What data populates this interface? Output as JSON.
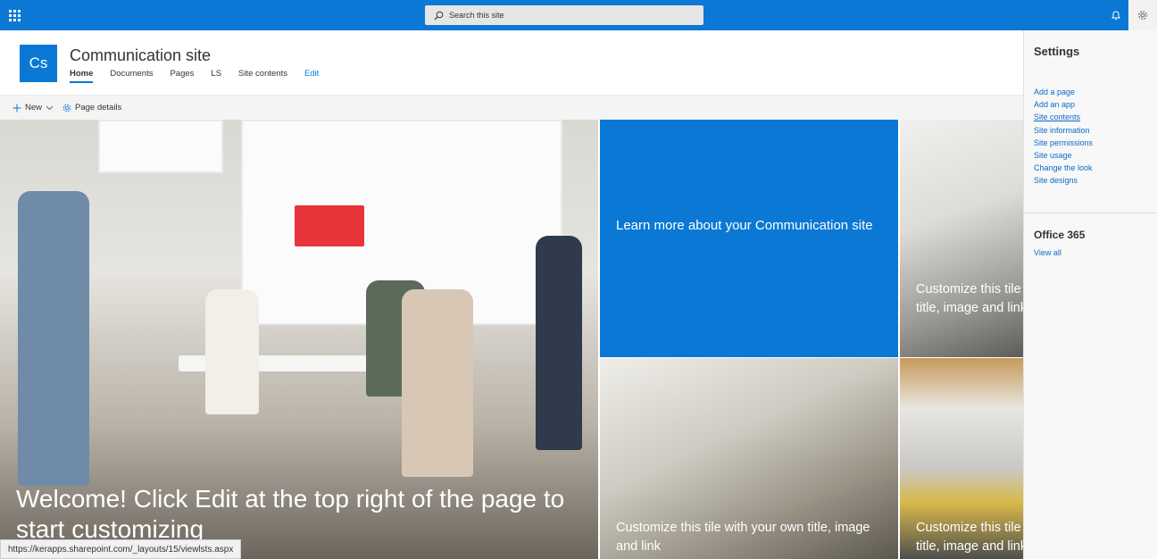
{
  "suite": {
    "search_placeholder": "Search this site"
  },
  "site": {
    "logo_initials": "Cs",
    "title": "Communication site",
    "nav": [
      "Home",
      "Documents",
      "Pages",
      "LS",
      "Site contents",
      "Edit"
    ]
  },
  "commandbar": {
    "new_label": "New",
    "page_details_label": "Page details"
  },
  "hero": {
    "main_title": "Welcome! Click Edit at the top right of the page to start customizing",
    "blue_tile": "Learn more about your Communication site",
    "tile_top_right": "Customize this tile with your own title, image and link",
    "tile_bottom_middle": "Customize this tile with your own title, image and link",
    "tile_bottom_right": "Customize this tile with your own title, image and link"
  },
  "status_bar": {
    "url": "https://kerapps.sharepoint.com/_layouts/15/viewlsts.aspx"
  },
  "settings_panel": {
    "title": "Settings",
    "links": [
      "Add a page",
      "Add an app",
      "Site contents",
      "Site information",
      "Site permissions",
      "Site usage",
      "Change the look",
      "Site designs"
    ],
    "section_title": "Office 365",
    "view_all": "View all"
  },
  "colors": {
    "brand_blue": "#0a78d4",
    "link_blue": "#0a6ac9"
  }
}
